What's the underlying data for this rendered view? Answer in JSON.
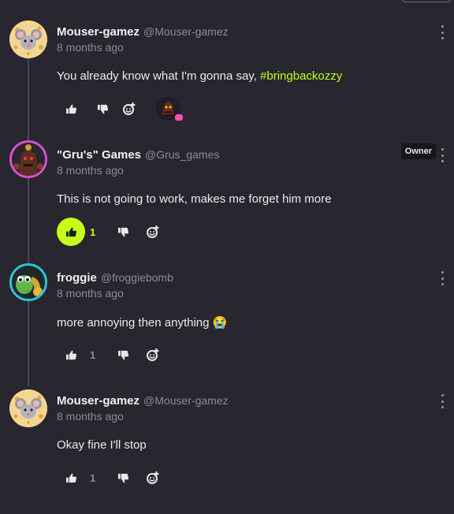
{
  "comments": [
    {
      "name": "Mouser-gamez",
      "handle": "@Mouser-gamez",
      "time": "8 months ago",
      "text_plain": "You already know what I'm gonna say, ",
      "hashtag": "#bringbackozzy",
      "likes": "",
      "liked": false
    },
    {
      "name": "\"Gru's\" Games",
      "handle": "@Grus_games",
      "badge": "Owner",
      "time": "8 months ago",
      "text": "This is not going to work, makes me forget him more",
      "likes": "1",
      "liked": true
    },
    {
      "name": "froggie",
      "handle": "@froggiebomb",
      "time": "8 months ago",
      "text": "more annoying then anything 😭",
      "likes": "1",
      "liked": false
    },
    {
      "name": "Mouser-gamez",
      "handle": "@Mouser-gamez",
      "time": "8 months ago",
      "text": "Okay fine I'll stop",
      "likes": "1",
      "liked": false
    }
  ],
  "icons": {
    "like": "thumbs-up-icon",
    "dislike": "thumbs-down-icon",
    "react": "add-reaction-icon",
    "more": "more-vertical-icon"
  },
  "colors": {
    "background": "#28262e",
    "accent": "#c6ff1b",
    "muted": "#8c8a95",
    "reaction_badge": "#ff4fb4",
    "avatar_ring_gru": "#d54fd0",
    "avatar_ring_froggie": "#2ec4d8"
  }
}
